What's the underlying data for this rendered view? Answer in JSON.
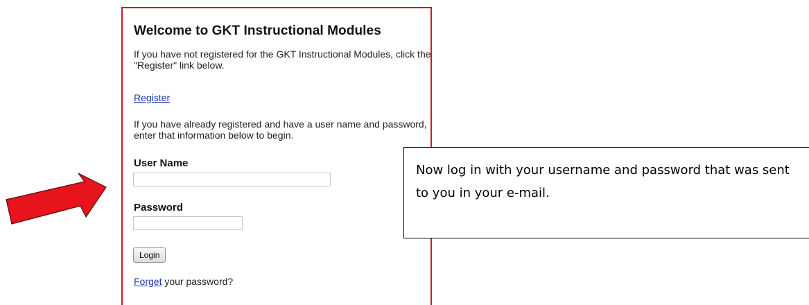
{
  "login_panel": {
    "title": "Welcome to GKT Instructional Modules",
    "intro_text": "If you have not registered for the GKT Instructional Modules, click the \"Register\" link below.",
    "register_link": "Register",
    "info_text": "If you have already registered and have a user name and password, enter that information below to begin.",
    "username_label": "User Name",
    "username_value": "",
    "password_label": "Password",
    "password_value": "",
    "login_button": "Login",
    "forget_link": "Forget",
    "forget_suffix": " your password?"
  },
  "callout": {
    "text": "Now log in with your username and password that was sent to you in your e-mail."
  },
  "colors": {
    "panel_border": "#d0191f",
    "link": "#1a33b4",
    "arrow_fill": "#e8141b",
    "arrow_stroke": "#5a0a0a"
  },
  "icons": {
    "arrow": "red-arrow-icon"
  }
}
